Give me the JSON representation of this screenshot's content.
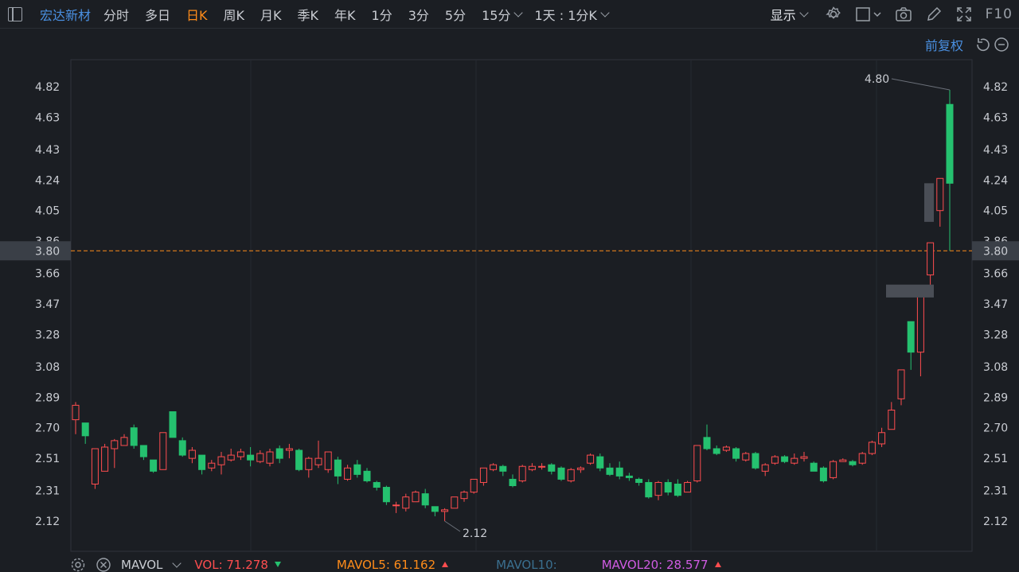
{
  "topbar": {
    "stock_name": "宏达新材",
    "tabs": [
      {
        "label": "分时",
        "active": false
      },
      {
        "label": "多日",
        "active": false
      },
      {
        "label": "日K",
        "active": true
      },
      {
        "label": "周K",
        "active": false
      },
      {
        "label": "月K",
        "active": false
      },
      {
        "label": "季K",
        "active": false
      },
      {
        "label": "年K",
        "active": false
      },
      {
        "label": "1分",
        "active": false
      },
      {
        "label": "3分",
        "active": false
      },
      {
        "label": "5分",
        "active": false
      }
    ],
    "interval_dropdown": "15分",
    "range_dropdown": "1天 : 1分K",
    "show_label": "显示",
    "f10_label": "F10"
  },
  "adjust": {
    "label": "前复权"
  },
  "colors": {
    "up": "#ff4d4f",
    "down": "#25c16f",
    "accent": "#ff8c1a",
    "brand": "#4a90e2"
  },
  "chart_data": {
    "type": "candlestick",
    "y_ticks": [
      "4.82",
      "4.63",
      "4.43",
      "4.24",
      "4.05",
      "3.86",
      "3.66",
      "3.47",
      "3.28",
      "3.08",
      "2.89",
      "2.70",
      "2.51",
      "2.31",
      "2.12"
    ],
    "ylim": [
      2.12,
      4.82
    ],
    "current_price": "3.80",
    "high_annotation": "4.80",
    "low_annotation": "2.12",
    "candles": [
      [
        2.75,
        2.84,
        2.66,
        2.86
      ],
      [
        2.73,
        2.65,
        2.6,
        2.73
      ],
      [
        2.35,
        2.57,
        2.32,
        2.57
      ],
      [
        2.43,
        2.58,
        2.43,
        2.6
      ],
      [
        2.57,
        2.62,
        2.45,
        2.63
      ],
      [
        2.59,
        2.64,
        2.59,
        2.66
      ],
      [
        2.7,
        2.59,
        2.57,
        2.72
      ],
      [
        2.59,
        2.52,
        2.5,
        2.59
      ],
      [
        2.5,
        2.43,
        2.42,
        2.5
      ],
      [
        2.44,
        2.67,
        2.44,
        2.67
      ],
      [
        2.8,
        2.64,
        2.64,
        2.8
      ],
      [
        2.62,
        2.53,
        2.52,
        2.64
      ],
      [
        2.51,
        2.56,
        2.48,
        2.58
      ],
      [
        2.53,
        2.44,
        2.41,
        2.53
      ],
      [
        2.45,
        2.48,
        2.43,
        2.5
      ],
      [
        2.47,
        2.52,
        2.41,
        2.55
      ],
      [
        2.5,
        2.53,
        2.49,
        2.57
      ],
      [
        2.52,
        2.55,
        2.5,
        2.57
      ],
      [
        2.53,
        2.5,
        2.46,
        2.58
      ],
      [
        2.49,
        2.54,
        2.48,
        2.56
      ],
      [
        2.48,
        2.55,
        2.46,
        2.57
      ],
      [
        2.57,
        2.51,
        2.48,
        2.59
      ],
      [
        2.56,
        2.57,
        2.51,
        2.6
      ],
      [
        2.56,
        2.44,
        2.43,
        2.57
      ],
      [
        2.44,
        2.51,
        2.39,
        2.52
      ],
      [
        2.47,
        2.51,
        2.45,
        2.62
      ],
      [
        2.44,
        2.55,
        2.42,
        2.55
      ],
      [
        2.5,
        2.4,
        2.35,
        2.52
      ],
      [
        2.38,
        2.45,
        2.37,
        2.47
      ],
      [
        2.47,
        2.41,
        2.39,
        2.5
      ],
      [
        2.43,
        2.37,
        2.36,
        2.45
      ],
      [
        2.36,
        2.33,
        2.31,
        2.37
      ],
      [
        2.33,
        2.24,
        2.22,
        2.34
      ],
      [
        2.22,
        2.22,
        2.17,
        2.24
      ],
      [
        2.2,
        2.27,
        2.18,
        2.29
      ],
      [
        2.24,
        2.3,
        2.24,
        2.31
      ],
      [
        2.29,
        2.22,
        2.2,
        2.32
      ],
      [
        2.21,
        2.18,
        2.15,
        2.21
      ],
      [
        2.18,
        2.19,
        2.12,
        2.2
      ],
      [
        2.2,
        2.27,
        2.2,
        2.27
      ],
      [
        2.26,
        2.3,
        2.24,
        2.31
      ],
      [
        2.3,
        2.38,
        2.29,
        2.38
      ],
      [
        2.36,
        2.45,
        2.34,
        2.45
      ],
      [
        2.44,
        2.47,
        2.43,
        2.48
      ],
      [
        2.46,
        2.43,
        2.4,
        2.47
      ],
      [
        2.38,
        2.34,
        2.33,
        2.41
      ],
      [
        2.37,
        2.46,
        2.36,
        2.47
      ],
      [
        2.44,
        2.46,
        2.43,
        2.48
      ],
      [
        2.46,
        2.46,
        2.44,
        2.48
      ],
      [
        2.47,
        2.43,
        2.41,
        2.48
      ],
      [
        2.45,
        2.38,
        2.37,
        2.46
      ],
      [
        2.37,
        2.44,
        2.36,
        2.45
      ],
      [
        2.44,
        2.45,
        2.42,
        2.46
      ],
      [
        2.48,
        2.53,
        2.47,
        2.54
      ],
      [
        2.52,
        2.45,
        2.43,
        2.54
      ],
      [
        2.45,
        2.41,
        2.4,
        2.48
      ],
      [
        2.45,
        2.4,
        2.38,
        2.49
      ],
      [
        2.4,
        2.39,
        2.37,
        2.42
      ],
      [
        2.38,
        2.36,
        2.34,
        2.39
      ],
      [
        2.36,
        2.27,
        2.26,
        2.38
      ],
      [
        2.28,
        2.36,
        2.25,
        2.37
      ],
      [
        2.36,
        2.3,
        2.28,
        2.38
      ],
      [
        2.35,
        2.28,
        2.27,
        2.38
      ],
      [
        2.3,
        2.36,
        2.3,
        2.37
      ],
      [
        2.37,
        2.59,
        2.36,
        2.59
      ],
      [
        2.64,
        2.57,
        2.56,
        2.72
      ],
      [
        2.57,
        2.54,
        2.53,
        2.59
      ],
      [
        2.56,
        2.58,
        2.55,
        2.59
      ],
      [
        2.57,
        2.51,
        2.49,
        2.58
      ],
      [
        2.5,
        2.54,
        2.49,
        2.55
      ],
      [
        2.54,
        2.45,
        2.44,
        2.55
      ],
      [
        2.43,
        2.47,
        2.4,
        2.48
      ],
      [
        2.48,
        2.52,
        2.47,
        2.53
      ],
      [
        2.52,
        2.49,
        2.48,
        2.53
      ],
      [
        2.48,
        2.51,
        2.47,
        2.54
      ],
      [
        2.51,
        2.52,
        2.49,
        2.55
      ],
      [
        2.48,
        2.43,
        2.43,
        2.49
      ],
      [
        2.45,
        2.37,
        2.36,
        2.46
      ],
      [
        2.39,
        2.49,
        2.38,
        2.5
      ],
      [
        2.49,
        2.5,
        2.49,
        2.51
      ],
      [
        2.49,
        2.47,
        2.46,
        2.5
      ],
      [
        2.48,
        2.54,
        2.47,
        2.55
      ],
      [
        2.54,
        2.61,
        2.53,
        2.62
      ],
      [
        2.6,
        2.67,
        2.58,
        2.7
      ],
      [
        2.69,
        2.81,
        2.69,
        2.86
      ],
      [
        2.88,
        3.06,
        2.84,
        3.06
      ],
      [
        3.36,
        3.17,
        3.06,
        3.36
      ],
      [
        3.17,
        3.52,
        3.02,
        3.52
      ],
      [
        3.65,
        3.85,
        3.58,
        3.85
      ],
      [
        4.05,
        4.25,
        3.95,
        4.25
      ],
      [
        4.71,
        4.22,
        3.8,
        4.8
      ]
    ],
    "volume_legend": {
      "label": "MAVOL",
      "vol": "VOL: 71.278",
      "mavol5": "MAVOL5: 61.162",
      "mavol10": "MAVOL10:",
      "mavol20": "MAVOL20: 28.577"
    }
  }
}
